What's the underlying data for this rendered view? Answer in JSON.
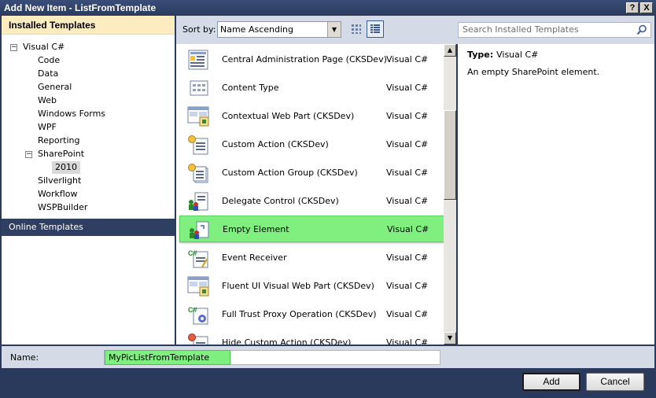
{
  "window": {
    "title": "Add New Item - ListFromTemplate",
    "help_glyph": "?",
    "close_glyph": "X"
  },
  "left_pane": {
    "installed_header": "Installed Templates",
    "tree": [
      {
        "label": "Visual C#",
        "expander": "−"
      },
      {
        "label": "Code"
      },
      {
        "label": "Data"
      },
      {
        "label": "General"
      },
      {
        "label": "Web"
      },
      {
        "label": "Windows Forms"
      },
      {
        "label": "WPF"
      },
      {
        "label": "Reporting"
      },
      {
        "label": "SharePoint",
        "expander": "−"
      },
      {
        "label": "2010",
        "selected": true
      },
      {
        "label": "Silverlight"
      },
      {
        "label": "Workflow"
      },
      {
        "label": "WSPBuilder"
      }
    ],
    "online_label": "Online Templates"
  },
  "toolbar": {
    "sort_label": "Sort by:",
    "sort_value": "Name Ascending"
  },
  "search": {
    "placeholder": "Search Installed Templates"
  },
  "templates": [
    {
      "name": "Central Administration Page (CKSDev)",
      "lang": "Visual C#",
      "icon": "page-icon"
    },
    {
      "name": "Content Type",
      "lang": "Visual C#",
      "icon": "content-type-icon"
    },
    {
      "name": "Contextual Web Part (CKSDev)",
      "lang": "Visual C#",
      "icon": "web-part-icon"
    },
    {
      "name": "Custom Action (CKSDev)",
      "lang": "Visual C#",
      "icon": "custom-action-icon"
    },
    {
      "name": "Custom Action Group (CKSDev)",
      "lang": "Visual C#",
      "icon": "custom-action-group-icon"
    },
    {
      "name": "Delegate Control (CKSDev)",
      "lang": "Visual C#",
      "icon": "delegate-control-icon"
    },
    {
      "name": "Empty Element",
      "lang": "Visual C#",
      "icon": "empty-element-icon",
      "selected": true
    },
    {
      "name": "Event Receiver",
      "lang": "Visual C#",
      "icon": "event-receiver-icon"
    },
    {
      "name": "Fluent UI Visual Web Part (CKSDev)",
      "lang": "Visual C#",
      "icon": "web-part-icon"
    },
    {
      "name": "Full Trust Proxy Operation (CKSDev)",
      "lang": "Visual C#",
      "icon": "proxy-operation-icon"
    },
    {
      "name": "Hide Custom Action (CKSDev)",
      "lang": "Visual C#",
      "icon": "hide-action-icon"
    }
  ],
  "details": {
    "type_label": "Type:",
    "type_value": "Visual C#",
    "description": "An empty SharePoint element."
  },
  "name_row": {
    "label": "Name:",
    "value": "MyPicListFromTemplate"
  },
  "buttons": {
    "add": "Add",
    "cancel": "Cancel"
  },
  "colors": {
    "selection": "#7fef7f",
    "header_bg": "#fcecc0",
    "frame": "#2a3a5c"
  }
}
